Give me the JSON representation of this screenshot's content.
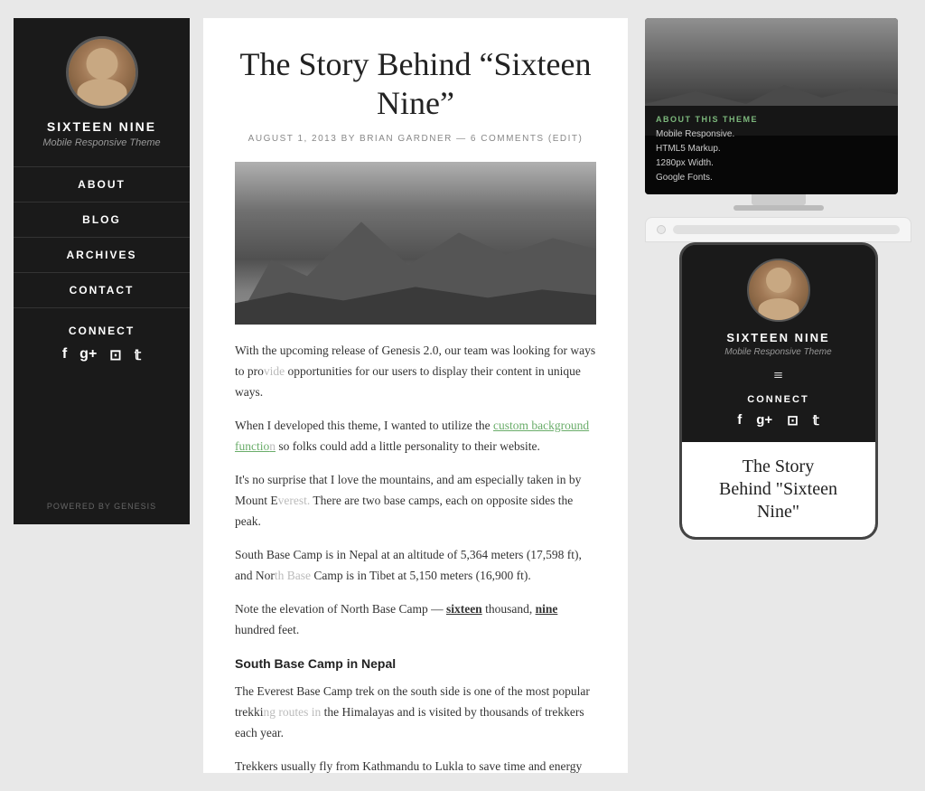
{
  "site": {
    "title": "SIXTEEN NINE",
    "subtitle": "Mobile Responsive Theme",
    "powered_by": "POWERED BY GENESIS"
  },
  "sidebar": {
    "nav_items": [
      "ABOUT",
      "BLOG",
      "ARCHIVES",
      "CONTACT"
    ],
    "connect_label": "CONNECT",
    "social_icons": [
      "f",
      "g+",
      "☺",
      "t"
    ]
  },
  "post": {
    "title": "The Story Behind “Sixteen Nine”",
    "meta": "AUGUST 1, 2013 BY BRIAN GARDNER — 6 COMMENTS (EDIT)",
    "body": [
      "With the upcoming release of Genesis 2.0, our team was looking for ways to provide opportunities for our users to display their content in unique ways.",
      "When I developed this theme, I wanted to utilize the custom background function so folks could add a little personality to their website.",
      "It’s no surprise that I love the mountains, and am especially taken in by Mount Everest. There are two base camps, each on opposite sides the peak.",
      "South Base Camp is in Nepal at an altitude of 5,364 meters (17,598 ft), and North Base Camp is in Tibet at 5,150 meters (16,900 ft).",
      "Note the elevation of North Base Camp — sixteen thousand, nine hundred feet."
    ],
    "subheading": "South Base Camp in Nepal",
    "sub_body": [
      "The Everest Base Camp trek on the south side is one of the most popular trekking routes in the Himalayas and is visited by thousands of trekkers each year.",
      "Trekkers usually fly from Kathmandu to Lukla to save time and energy before beginning their morning trek to this base camp."
    ],
    "highlight1": "sixteen",
    "highlight2": "nine",
    "link_text": "custom background function"
  },
  "monitor_overlay": {
    "title": "ABOUT THIS THEME",
    "lines": [
      "Mobile Responsive.",
      "HTML5 Markup.",
      "1280px Width.",
      "Google Fonts."
    ]
  },
  "phone_blog_title": "The Story Behind “Sixteen Nine”"
}
